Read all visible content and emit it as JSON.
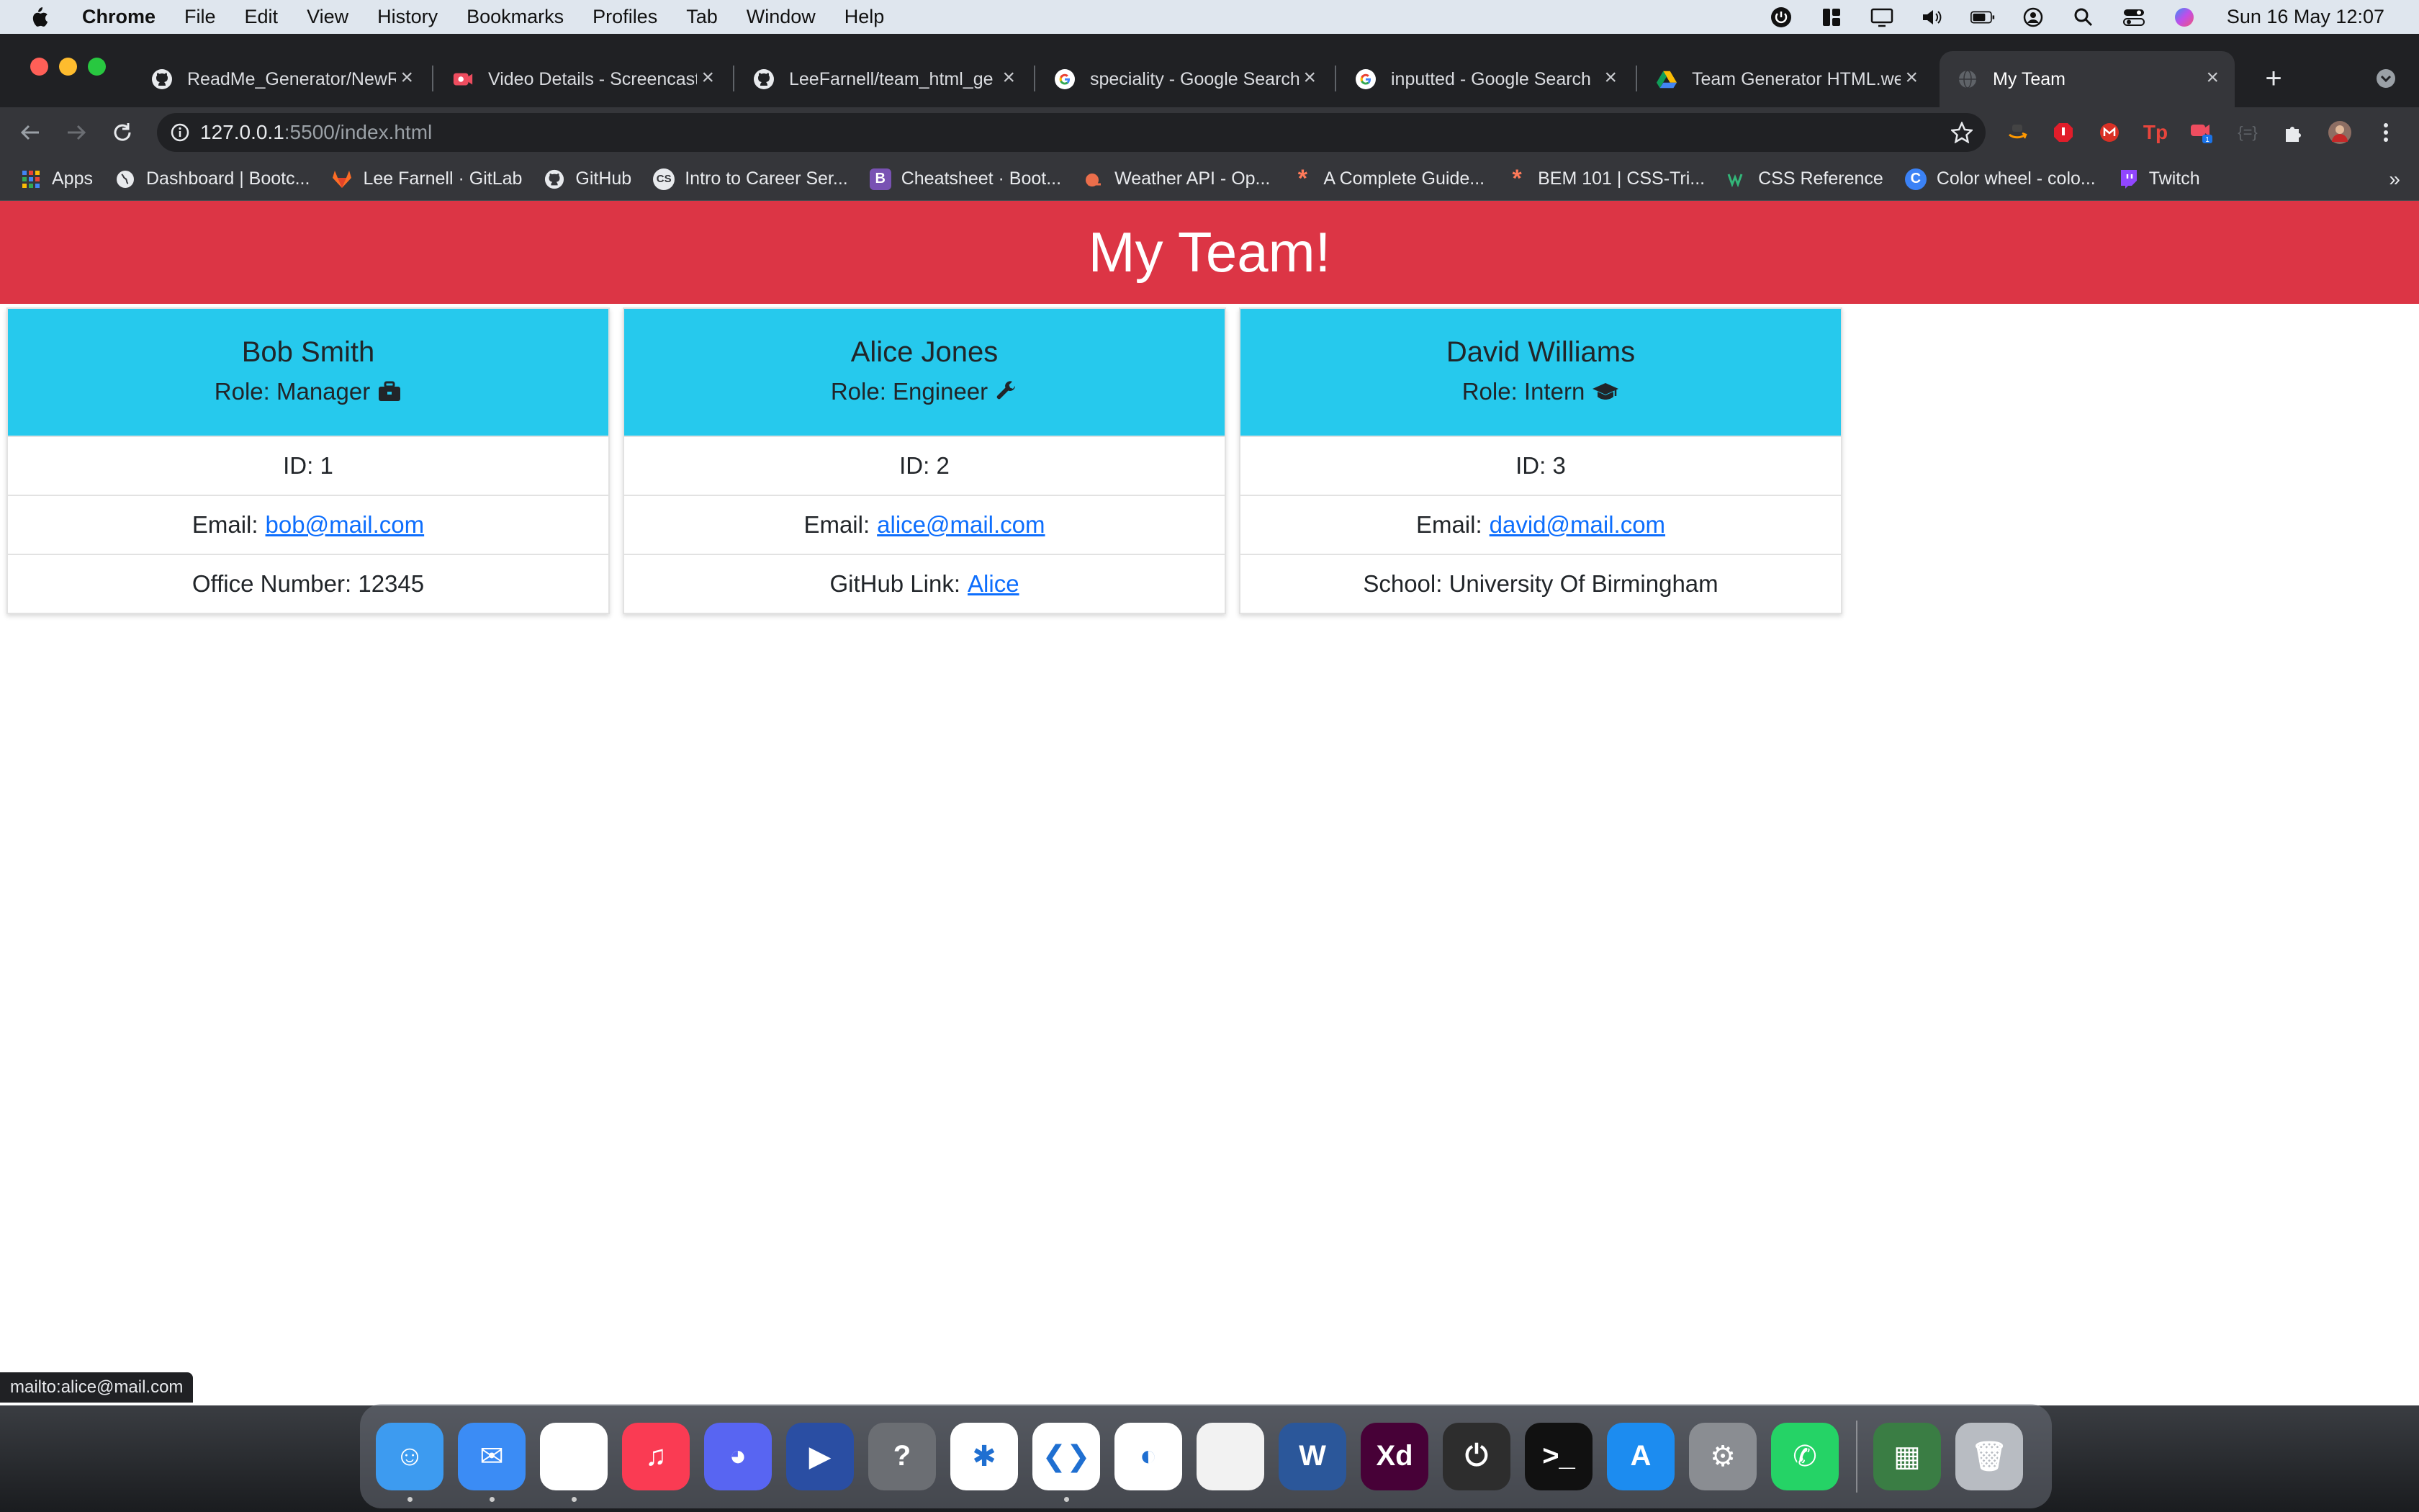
{
  "menubar": {
    "app": "Chrome",
    "items": [
      "File",
      "Edit",
      "View",
      "History",
      "Bookmarks",
      "Profiles",
      "Tab",
      "Window",
      "Help"
    ],
    "clock": "Sun 16 May  12:07"
  },
  "tabs": [
    {
      "title": "ReadMe_Generator/NewR",
      "icon": "github-icon"
    },
    {
      "title": "Video Details - Screencast",
      "icon": "screencast-icon"
    },
    {
      "title": "LeeFarnell/team_html_ge",
      "icon": "github-icon"
    },
    {
      "title": "speciality - Google Search",
      "icon": "google-icon"
    },
    {
      "title": "inputted - Google Search",
      "icon": "google-icon"
    },
    {
      "title": "Team Generator HTML.we",
      "icon": "drive-icon"
    },
    {
      "title": "My Team",
      "icon": "globe-icon"
    }
  ],
  "address": {
    "host": "127.0.0.1",
    "path": ":5500/index.html"
  },
  "bookmarks": [
    {
      "label": "Apps",
      "icon": "apps-grid-icon",
      "color": "#4285f4"
    },
    {
      "label": "Dashboard | Bootc...",
      "icon": "globe-icon",
      "color": "#5f6368"
    },
    {
      "label": "Lee Farnell · GitLab",
      "icon": "gitlab-icon",
      "color": "#fc6d26"
    },
    {
      "label": "GitHub",
      "icon": "github-icon",
      "color": "#24292e"
    },
    {
      "label": "Intro to Career Ser...",
      "icon": "cs-icon",
      "color": "#24292e"
    },
    {
      "label": "Cheatsheet · Boot...",
      "icon": "bootstrap-icon",
      "color": "#7952b3"
    },
    {
      "label": "Weather API - Op...",
      "icon": "openweather-icon",
      "color": "#eb6e4b"
    },
    {
      "label": "A Complete Guide...",
      "icon": "csstricks-icon",
      "color": "#ff7a59"
    },
    {
      "label": "BEM 101 | CSS-Tri...",
      "icon": "csstricks-icon",
      "color": "#ff7a59"
    },
    {
      "label": "CSS Reference",
      "icon": "cssref-icon",
      "color": "#33b679"
    },
    {
      "label": "Color wheel - colo...",
      "icon": "canva-icon",
      "color": "#3b82f6"
    },
    {
      "label": "Twitch",
      "icon": "twitch-icon",
      "color": "#9146ff"
    }
  ],
  "page": {
    "heading": "My Team!",
    "cards": [
      {
        "name": "Bob Smith",
        "role": "Role: Manager",
        "role_icon": "briefcase-icon",
        "id": "ID: 1",
        "email_label": "Email:",
        "email": "bob@mail.com",
        "extra_label": "Office Number: 12345",
        "extra_link": ""
      },
      {
        "name": "Alice Jones",
        "role": "Role: Engineer",
        "role_icon": "wrench-icon",
        "id": "ID: 2",
        "email_label": "Email:",
        "email": "alice@mail.com",
        "extra_label": "GitHub Link:",
        "extra_link": "Alice"
      },
      {
        "name": "David Williams",
        "role": "Role: Intern",
        "role_icon": "graduation-cap-icon",
        "id": "ID: 3",
        "email_label": "Email:",
        "email": "david@mail.com",
        "extra_label": "School: University Of Birmingham",
        "extra_link": ""
      }
    ]
  },
  "status_bar": "mailto:alice@mail.com",
  "dock": [
    {
      "name": "finder-icon",
      "color": "#3d9bf0",
      "glyph": "☺"
    },
    {
      "name": "mail-icon",
      "color": "#3b8cf5",
      "glyph": "✉"
    },
    {
      "name": "chrome-icon",
      "color": "#ffffff",
      "glyph": ""
    },
    {
      "name": "music-icon",
      "color": "#fa3b53",
      "glyph": "♫"
    },
    {
      "name": "discord-icon",
      "color": "#5865f2",
      "glyph": "◕"
    },
    {
      "name": "pokemon-tcg-icon",
      "color": "#2a4ea3",
      "glyph": "▶"
    },
    {
      "name": "help-icon",
      "color": "#6b6e73",
      "glyph": "?"
    },
    {
      "name": "slack-icon",
      "color": "#ffffff",
      "glyph": "✱"
    },
    {
      "name": "vscode-icon",
      "color": "#ffffff",
      "glyph": "❮❯"
    },
    {
      "name": "moon-app-icon",
      "color": "#ffffff",
      "glyph": "◐"
    },
    {
      "name": "blank-document-icon",
      "color": "#f2f2f2",
      "glyph": ""
    },
    {
      "name": "word-icon",
      "color": "#2b579a",
      "glyph": "W"
    },
    {
      "name": "adobe-xd-icon",
      "color": "#470137",
      "glyph": "Xd"
    },
    {
      "name": "power-app-icon",
      "color": "#2d2d2d",
      "glyph": "⏻"
    },
    {
      "name": "terminal-icon",
      "color": "#111111",
      "glyph": ">_"
    },
    {
      "name": "app-store-icon",
      "color": "#1c8cf0",
      "glyph": "A"
    },
    {
      "name": "system-preferences-icon",
      "color": "#8a8d92",
      "glyph": "⚙"
    },
    {
      "name": "whatsapp-icon",
      "color": "#25d366",
      "glyph": "✆"
    }
  ],
  "dock_extra": [
    {
      "name": "preview-thumbnail-icon",
      "color": "#3a7d44",
      "glyph": "▦"
    },
    {
      "name": "trash-icon",
      "color": "#b8bcc2",
      "glyph": "🗑"
    }
  ]
}
